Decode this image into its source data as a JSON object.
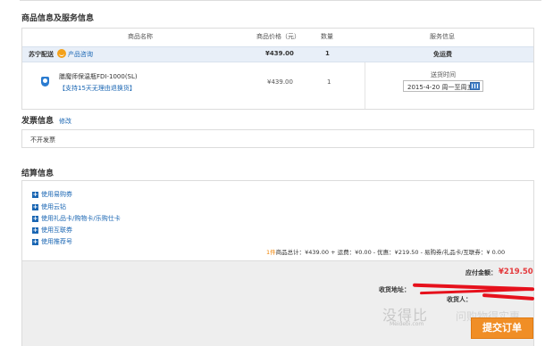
{
  "order": {
    "section_title": "商品信息及服务信息",
    "headers": {
      "name": "商品名称",
      "price": "商品价格（元）",
      "qty": "数量",
      "service": "服务信息"
    },
    "supplier": {
      "name": "苏宁配送",
      "consult": "产品咨询",
      "price": "¥439.00",
      "qty": "1",
      "shipping": "免运费"
    },
    "product": {
      "name": "膳魔师保温瓶FDI-1000(SL)",
      "promo": "【支持15天无理由退换货】",
      "price": "¥439.00",
      "qty": "1",
      "delivery_label": "送货时间",
      "delivery_value": "2015-4-20 周一至周五"
    }
  },
  "invoice": {
    "section_title": "发票信息",
    "edit_link": "修改",
    "value": "不开发票"
  },
  "settlement": {
    "section_title": "结算信息",
    "options": [
      "使用易购券",
      "使用云钻",
      "使用礼品卡/购物卡/乐购仕卡",
      "使用互联券",
      "使用推荐号"
    ],
    "summary": {
      "count": "1件",
      "text": "商品总计：¥439.00 + 运费：¥0.00 - 优惠：¥219.50 - 易购券/礼品卡/互联券：¥ 0.00"
    },
    "pay_label": "应付金额：",
    "pay_value": "¥219.50",
    "address_label": "收货地址：",
    "receiver_label": "收货人：",
    "submit_label": "提交订单"
  },
  "watermark": {
    "text": "没得比",
    "sub": "Meidebi.com",
    "right": "问购物得实惠"
  },
  "colors": {
    "link": "#1a66b3",
    "price_red": "#e4393c",
    "submit_orange": "#f08e26",
    "count_orange": "#f08200"
  }
}
